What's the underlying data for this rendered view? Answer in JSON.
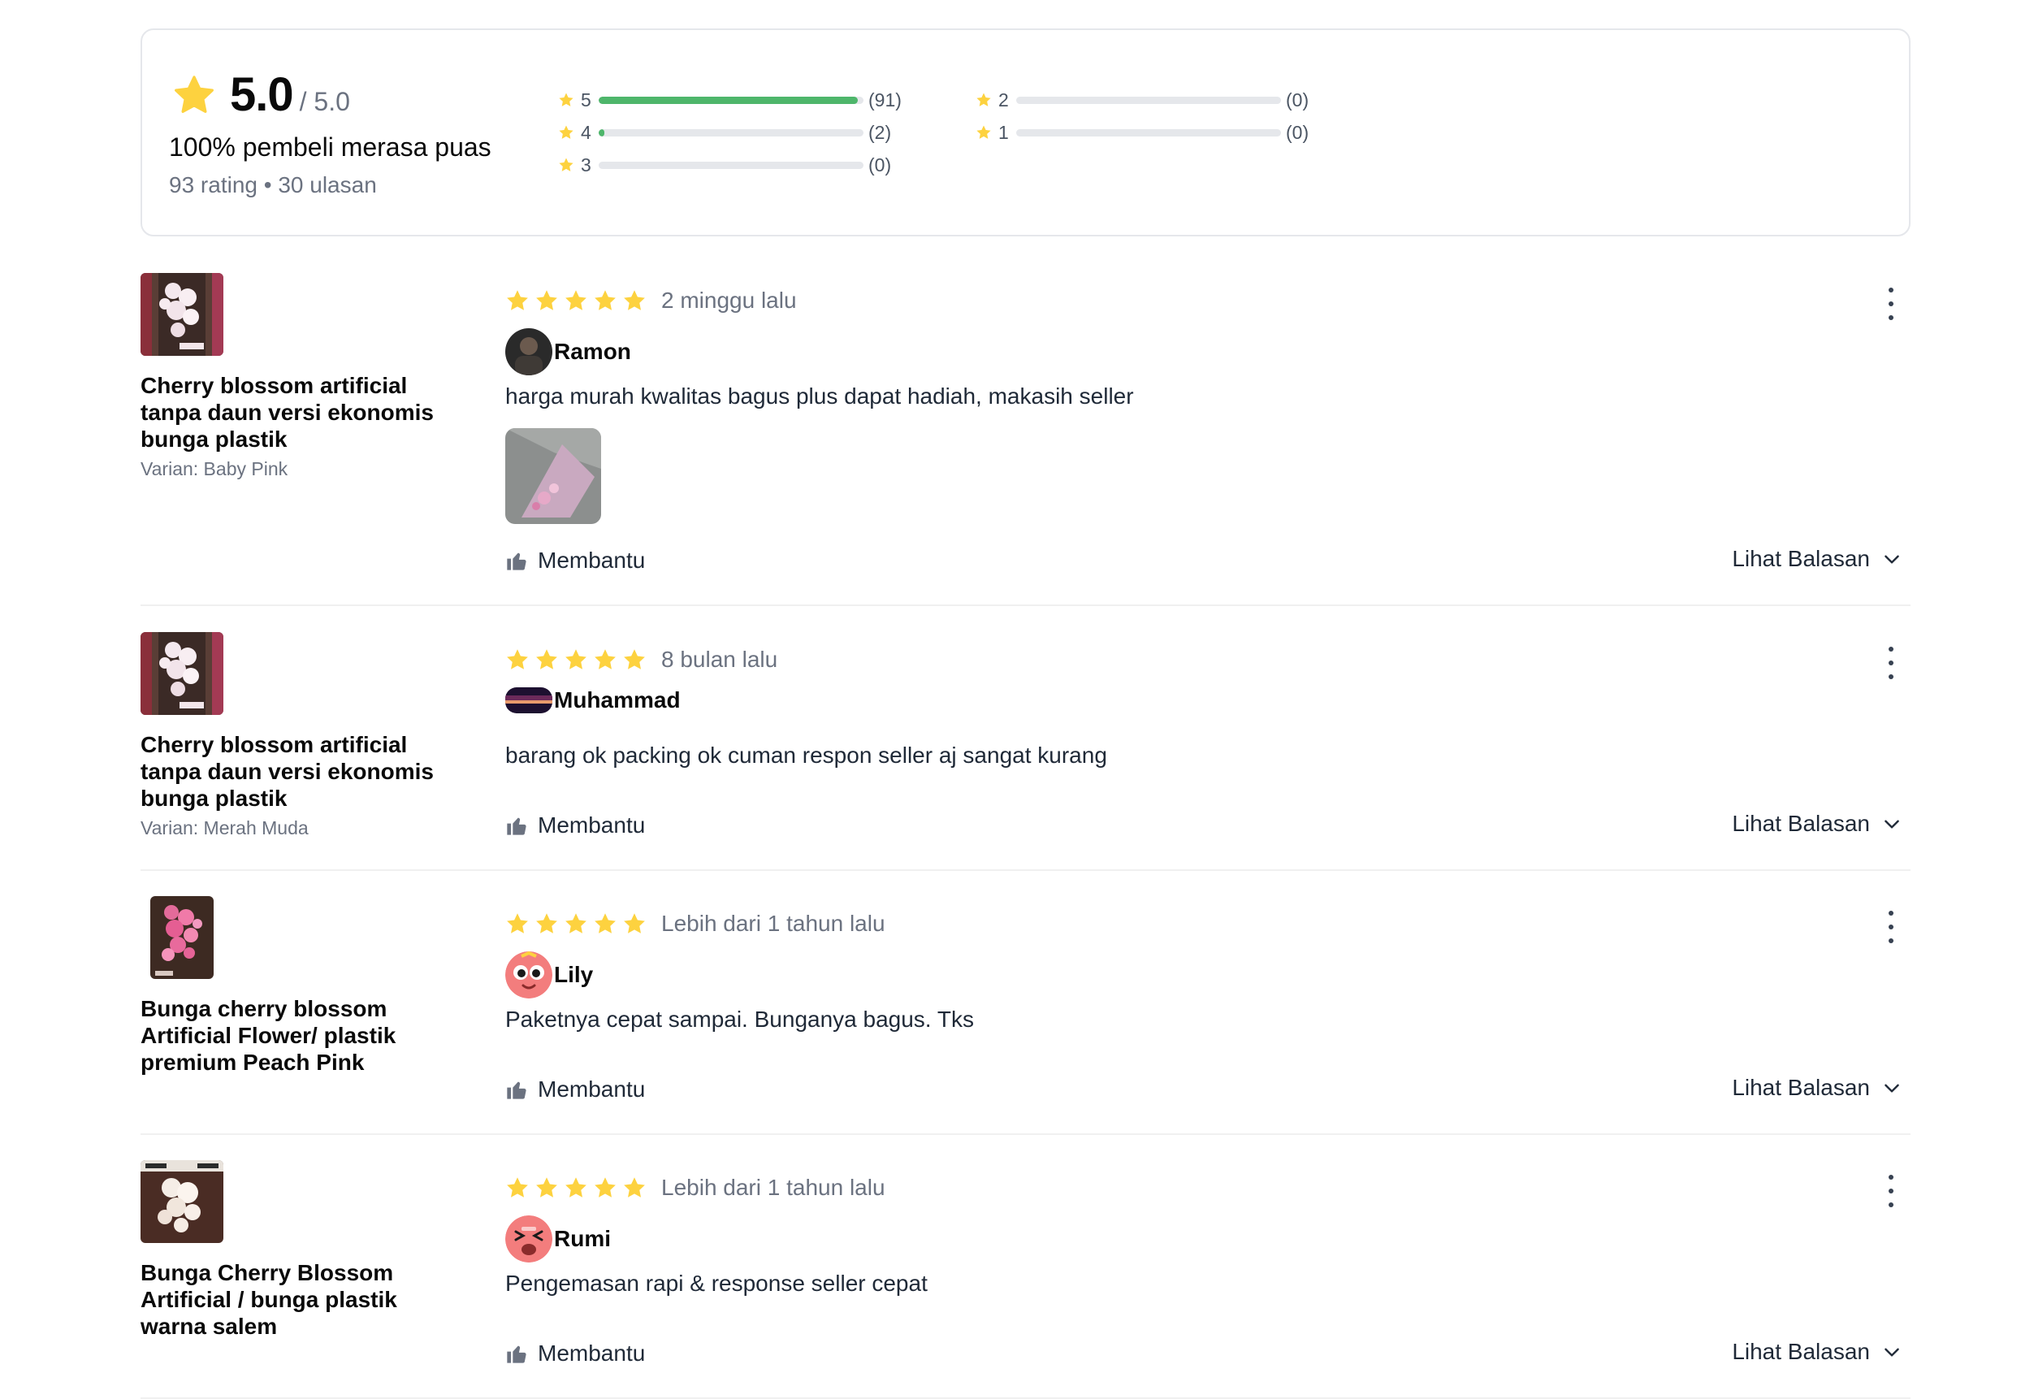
{
  "summary": {
    "score": "5.0",
    "score_max": "/ 5.0",
    "satisfaction": "100% pembeli merasa puas",
    "counts": "93 rating • 30 ulasan",
    "star_color": "#fdd23f",
    "bar_color": "#4eb66b",
    "distribution": [
      {
        "star": "5",
        "count": "(91)",
        "fraction": 0.978
      },
      {
        "star": "4",
        "count": "(2)",
        "fraction": 0.022
      },
      {
        "star": "3",
        "count": "(0)",
        "fraction": 0
      },
      {
        "star": "2",
        "count": "(0)",
        "fraction": 0
      },
      {
        "star": "1",
        "count": "(0)",
        "fraction": 0
      }
    ]
  },
  "reviews": [
    {
      "product": "Cherry blossom artificial tanpa daun versi ekonomis bunga plastik",
      "variant": "Varian: Baby Pink",
      "rating": 5,
      "time": "2 minggu lalu",
      "user": "Ramon",
      "text": "harga murah kwalitas bagus plus dapat hadiah, makasih seller",
      "has_photo": true,
      "helpful_label": "Membantu",
      "replies_label": "Lihat Balasan"
    },
    {
      "product": "Cherry blossom artificial tanpa daun versi ekonomis bunga plastik",
      "variant": "Varian: Merah Muda",
      "rating": 5,
      "time": "8 bulan lalu",
      "user": "Muhammad",
      "text": "barang ok packing ok cuman respon seller aj sangat kurang",
      "has_photo": false,
      "helpful_label": "Membantu",
      "replies_label": "Lihat Balasan"
    },
    {
      "product": "Bunga cherry blossom Artificial Flower/ plastik premium Peach Pink",
      "variant": "",
      "rating": 5,
      "time": "Lebih dari 1 tahun lalu",
      "user": "Lily",
      "text": "Paketnya cepat sampai. Bunganya bagus. Tks",
      "has_photo": false,
      "helpful_label": "Membantu",
      "replies_label": "Lihat Balasan"
    },
    {
      "product": "Bunga Cherry Blossom Artificial / bunga plastik warna salem",
      "variant": "",
      "rating": 5,
      "time": "Lebih dari 1 tahun lalu",
      "user": "Rumi",
      "text": "Pengemasan rapi & response seller cepat",
      "has_photo": false,
      "helpful_label": "Membantu",
      "replies_label": "Lihat Balasan"
    }
  ]
}
